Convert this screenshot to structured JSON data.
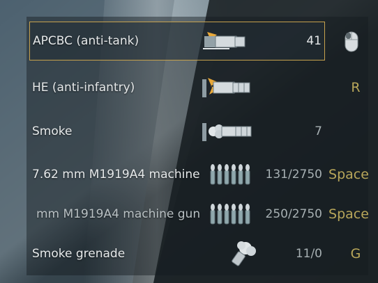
{
  "ammo_rows": [
    {
      "label": "APCBC (anti-tank)",
      "count": "41",
      "key": "",
      "icon": "apcbc-shell-icon",
      "selected": true
    },
    {
      "label": "HE (anti-infantry)",
      "count": "",
      "key": "R",
      "icon": "he-shell-icon",
      "selected": false
    },
    {
      "label": "Smoke",
      "count": "7",
      "key": "",
      "icon": "smoke-shell-icon",
      "selected": false
    },
    {
      "label": "7.62 mm M1919A4 machine",
      "count": "131/2750",
      "key": "Space",
      "icon": "mg-belt-icon",
      "selected": false
    },
    {
      "label": "mm M1919A4 machine gun",
      "count": "250/2750",
      "key": "Space",
      "icon": "mg-belt-icon",
      "selected": false
    },
    {
      "label": "Smoke grenade",
      "count": "11/0",
      "key": "G",
      "icon": "smoke-grenade-icon",
      "selected": false
    }
  ],
  "selected_key_icon": "mouse-icon",
  "colors": {
    "accent": "#c7a24d",
    "key_text": "#b9a75a",
    "label_text": "#e6e9ea"
  }
}
